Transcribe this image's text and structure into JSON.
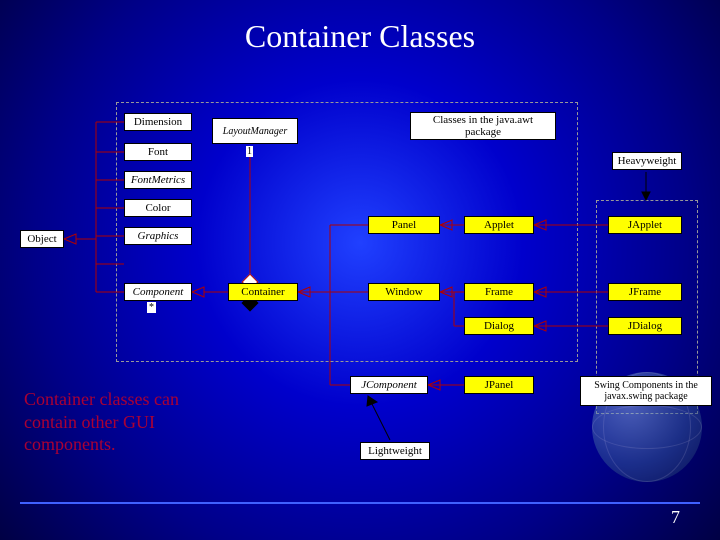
{
  "title": "Container Classes",
  "caption": "Container classes can contain other GUI components.",
  "pageNumber": "7",
  "labels": {
    "awtPackage": "Classes in the java.awt package",
    "heavyweight": "Heavyweight",
    "lightweight": "Lightweight",
    "swingPackage": "Swing Components in the javax.swing package"
  },
  "nodes": {
    "object": "Object",
    "dimension": "Dimension",
    "font": "Font",
    "fontMetrics": "FontMetrics",
    "color": "Color",
    "graphics": "Graphics",
    "component": "Component",
    "layoutManager": "LayoutManager",
    "container": "Container",
    "panel": "Panel",
    "window": "Window",
    "jcomponent": "JComponent",
    "applet": "Applet",
    "frame": "Frame",
    "dialog": "Dialog",
    "jpanel": "JPanel",
    "japplet": "JApplet",
    "jframe": "JFrame",
    "jdialog": "JDialog"
  },
  "multiplicity": {
    "one": "1",
    "many": "*"
  }
}
